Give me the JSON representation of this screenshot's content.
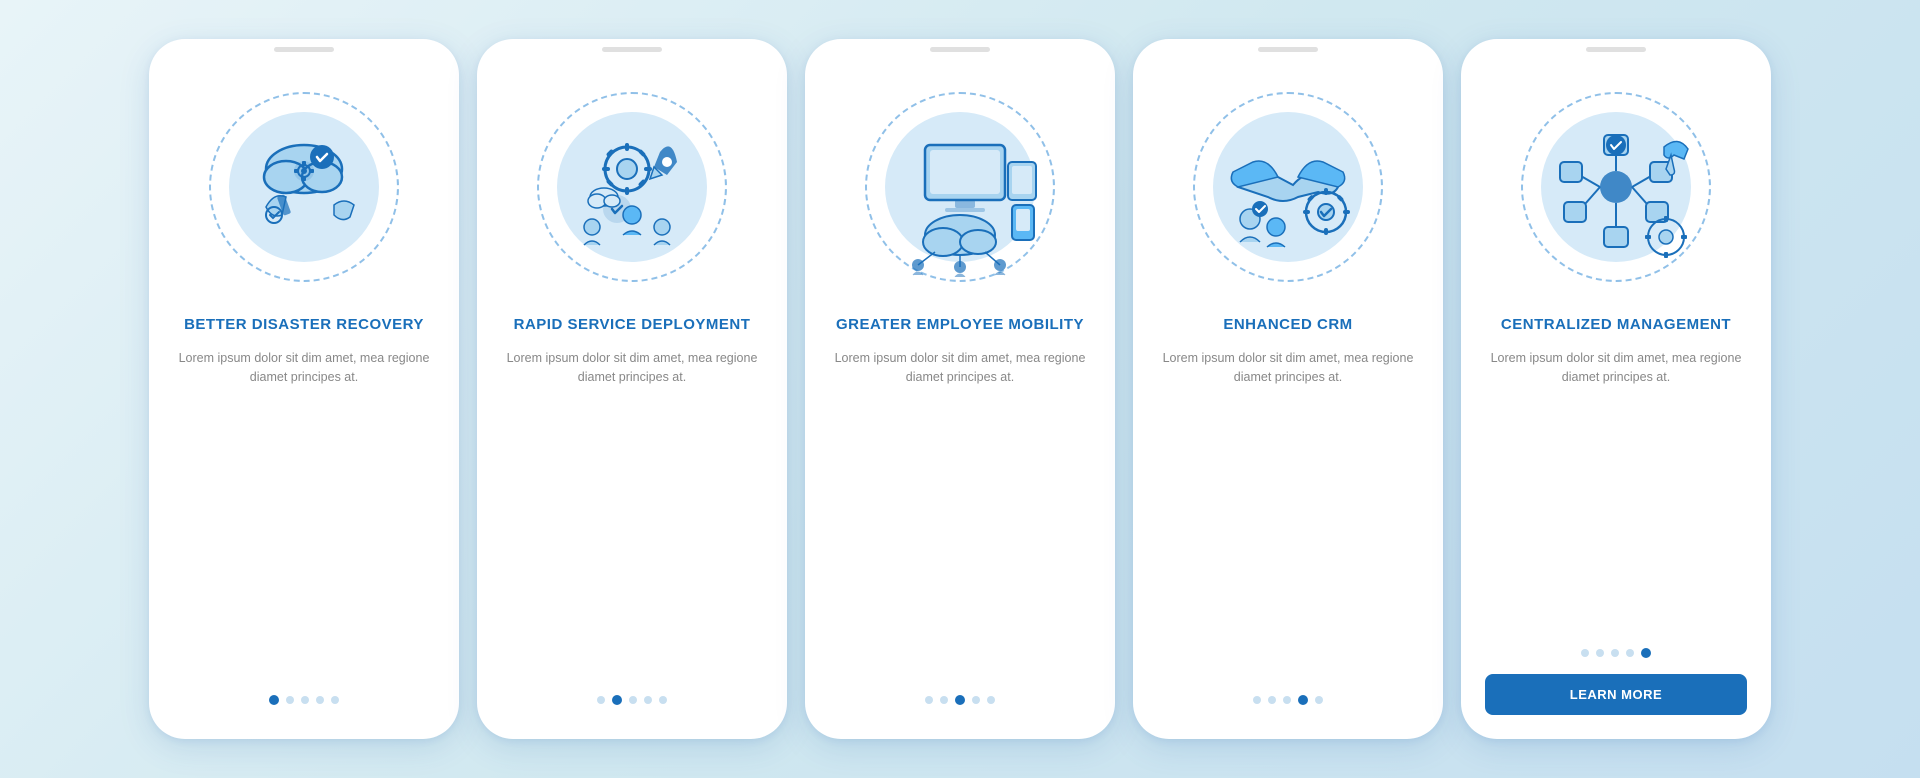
{
  "cards": [
    {
      "id": "card-1",
      "title": "BETTER DISASTER\nRECOVERY",
      "description": "Lorem ipsum dolor sit dim amet, mea regione diamet principes at.",
      "dots": [
        1,
        2,
        3,
        4,
        5
      ],
      "active_dot": 1,
      "show_button": false,
      "button_label": ""
    },
    {
      "id": "card-2",
      "title": "RAPID SERVICE\nDEPLOYMENT",
      "description": "Lorem ipsum dolor sit dim amet, mea regione diamet principes at.",
      "dots": [
        1,
        2,
        3,
        4,
        5
      ],
      "active_dot": 2,
      "show_button": false,
      "button_label": ""
    },
    {
      "id": "card-3",
      "title": "GREATER EMPLOYEE\nMOBILITY",
      "description": "Lorem ipsum dolor sit dim amet, mea regione diamet principes at.",
      "dots": [
        1,
        2,
        3,
        4,
        5
      ],
      "active_dot": 3,
      "show_button": false,
      "button_label": ""
    },
    {
      "id": "card-4",
      "title": "ENHANCED\nCRM",
      "description": "Lorem ipsum dolor sit dim amet, mea regione diamet principes at.",
      "dots": [
        1,
        2,
        3,
        4,
        5
      ],
      "active_dot": 4,
      "show_button": false,
      "button_label": ""
    },
    {
      "id": "card-5",
      "title": "CENTRALIZED\nMANAGEMENT",
      "description": "Lorem ipsum dolor sit dim amet, mea regione diamet principes at.",
      "dots": [
        1,
        2,
        3,
        4,
        5
      ],
      "active_dot": 5,
      "show_button": true,
      "button_label": "LEARN MORE"
    }
  ],
  "colors": {
    "primary": "#1a6fba",
    "light_blue": "#4a9fd4",
    "pale_blue": "#d6eaf8",
    "icon_stroke": "#1a6fba",
    "accent": "#5bb8f5"
  }
}
